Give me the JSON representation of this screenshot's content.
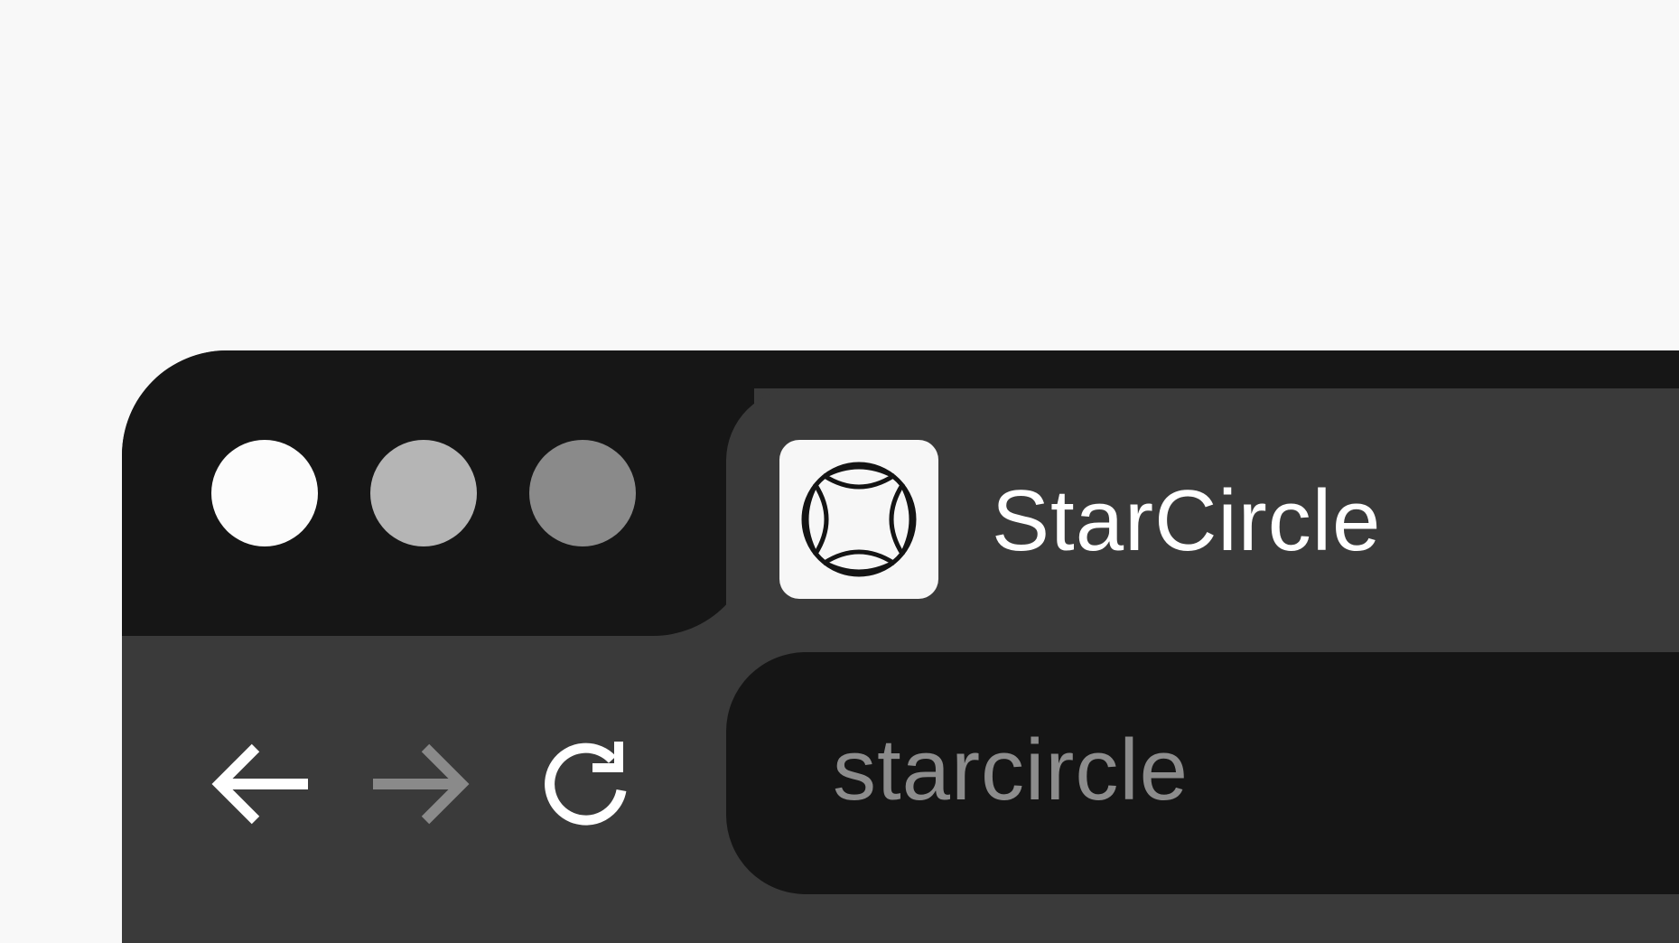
{
  "window": {
    "traffic_lights": {
      "close_color": "#fcfcfc",
      "minimize_color": "#b5b5b5",
      "maximize_color": "#8a8a8a"
    }
  },
  "tab": {
    "title": "StarCircle",
    "icon": "starcircle-logo-icon"
  },
  "toolbar": {
    "back_icon": "arrow-left-icon",
    "forward_icon": "arrow-right-icon",
    "reload_icon": "reload-icon",
    "back_enabled": true,
    "forward_enabled": false
  },
  "address_bar": {
    "value": "starcircle"
  },
  "colors": {
    "background": "#f8f8f8",
    "titlebar": "#161616",
    "chrome": "#3a3a3a",
    "address_bar": "#151515",
    "address_text": "#8c8c8c"
  }
}
